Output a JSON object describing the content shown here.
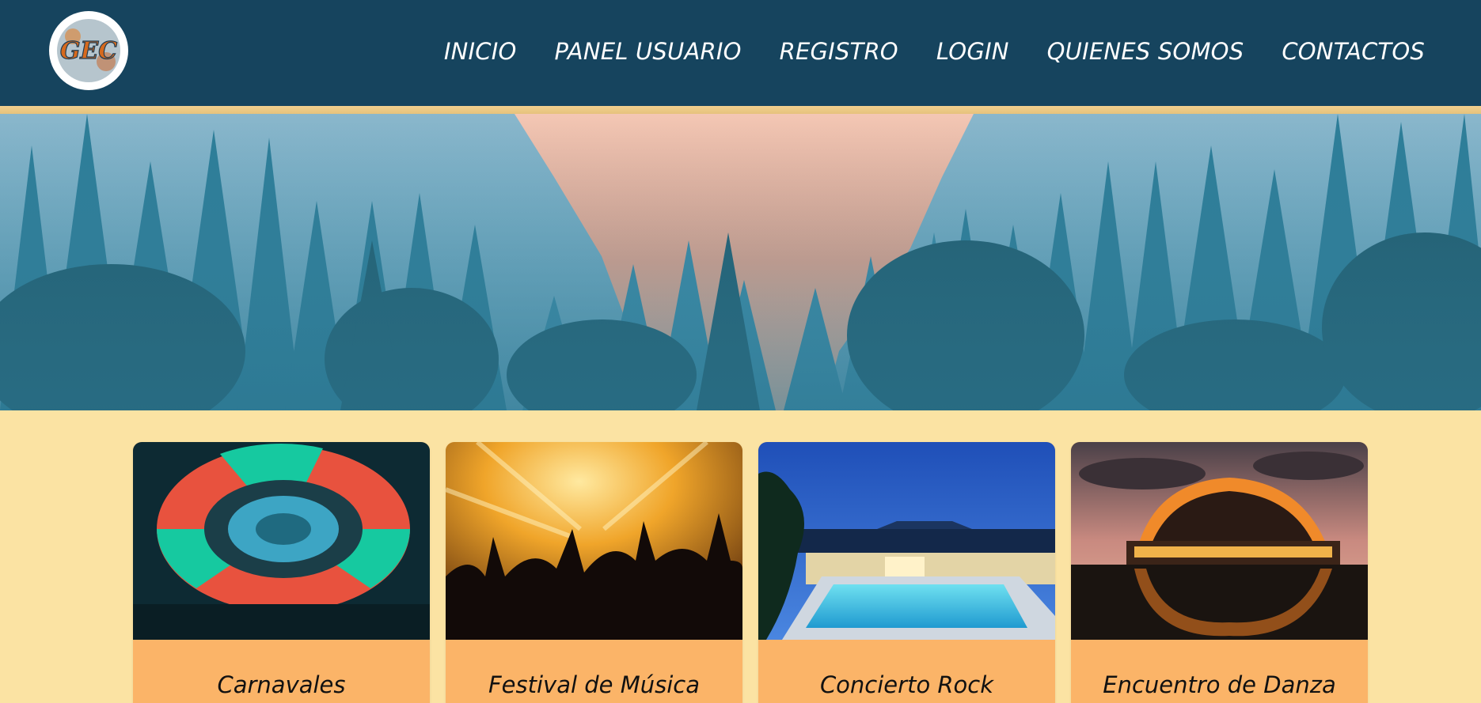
{
  "header": {
    "logo_text": "GEC",
    "nav": [
      {
        "label": "INICIO"
      },
      {
        "label": "PANEL USUARIO"
      },
      {
        "label": "REGISTRO"
      },
      {
        "label": "LOGIN"
      },
      {
        "label": "QUIENES SOMOS"
      },
      {
        "label": "CONTACTOS"
      }
    ]
  },
  "colors": {
    "header_bg": "#16445e",
    "page_bg": "#fbe3a3",
    "card_bg": "#fbb468"
  },
  "cards": [
    {
      "title": "Carnavales"
    },
    {
      "title": "Festival de Música"
    },
    {
      "title": "Concierto Rock"
    },
    {
      "title": "Encuentro de Danza"
    }
  ]
}
